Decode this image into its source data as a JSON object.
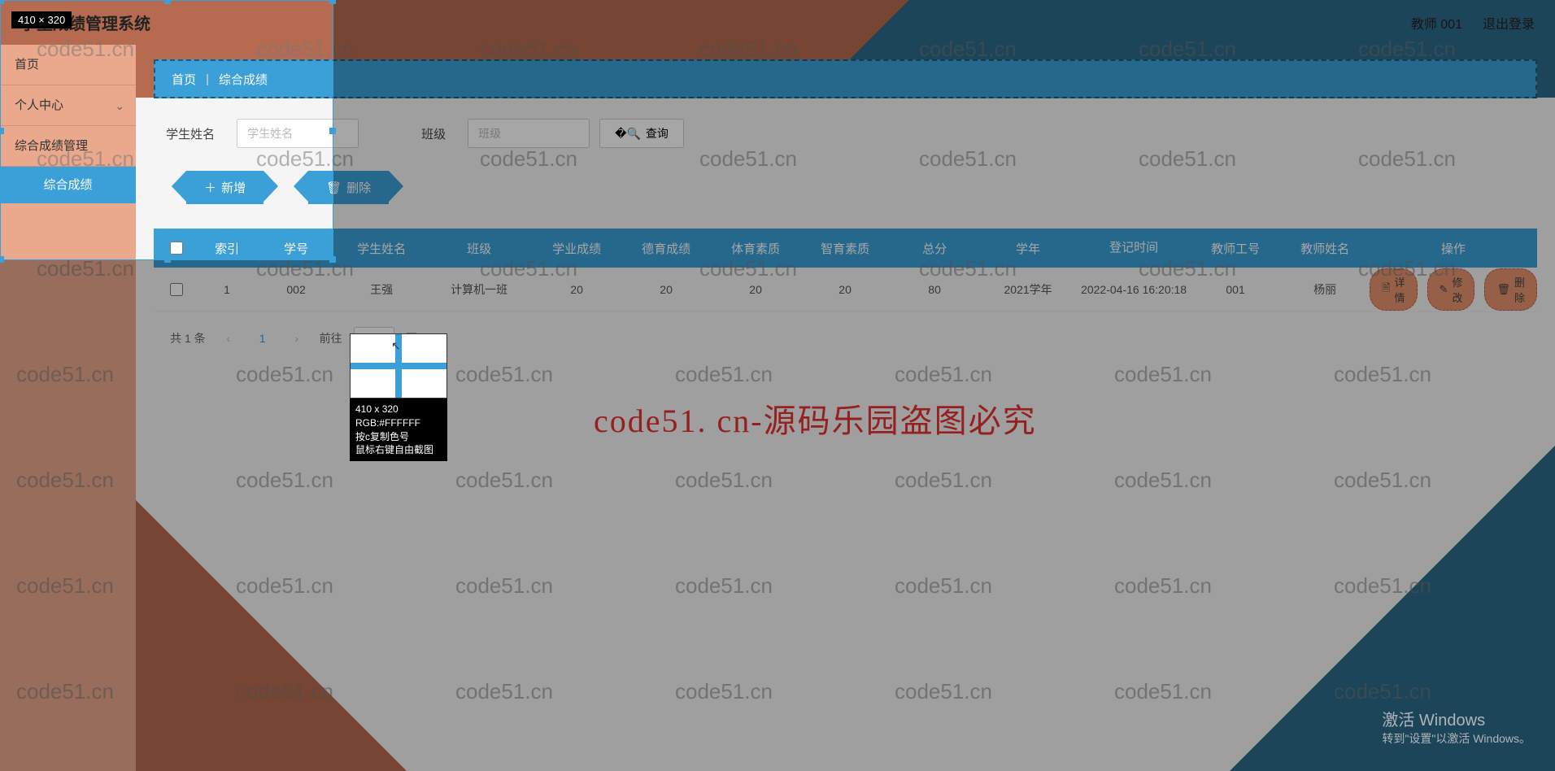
{
  "header": {
    "title": "学生成绩管理系统",
    "user": "教师 001",
    "logout": "退出登录"
  },
  "sidebar": {
    "items": [
      {
        "label": "首页"
      },
      {
        "label": "个人中心"
      },
      {
        "label": "综合成绩管理"
      }
    ],
    "sub": "综合成绩"
  },
  "crumb": {
    "home": "首页",
    "current": "综合成绩"
  },
  "search": {
    "name_label": "学生姓名",
    "name_ph": "学生姓名",
    "class_label": "班级",
    "class_ph": "班级",
    "btn": "查询"
  },
  "actions": {
    "add": "新增",
    "del": "删除"
  },
  "table": {
    "headers": [
      "索引",
      "学号",
      "学生姓名",
      "班级",
      "学业成绩",
      "德育成绩",
      "体育素质",
      "智育素质",
      "总分",
      "学年",
      "登记时间",
      "教师工号",
      "教师姓名",
      "操作"
    ],
    "rows": [
      {
        "idx": "1",
        "sno": "002",
        "name": "王强",
        "cls": "计算机一班",
        "s1": "20",
        "s2": "20",
        "s3": "20",
        "s4": "20",
        "total": "80",
        "year": "2021学年",
        "time": "2022-04-16 16:20:18",
        "tno": "001",
        "tname": "杨丽"
      }
    ],
    "row_btns": {
      "detail": "详情",
      "edit": "修改",
      "del": "删除"
    }
  },
  "pager": {
    "total": "共 1 条",
    "page": "1",
    "goto": "前往",
    "unit": "页"
  },
  "screenshot": {
    "dim": "410 × 320",
    "mag_l1": "410 x 320",
    "mag_l2": "RGB:#FFFFFF",
    "mag_l3": "按c复制色号",
    "mag_l4": "鼠标右键自由截图"
  },
  "watermark": {
    "text": "code51.cn",
    "red": "code51. cn-源码乐园盗图必究"
  },
  "windows": {
    "l1": "激活 Windows",
    "l2": "转到\"设置\"以激活 Windows。"
  }
}
